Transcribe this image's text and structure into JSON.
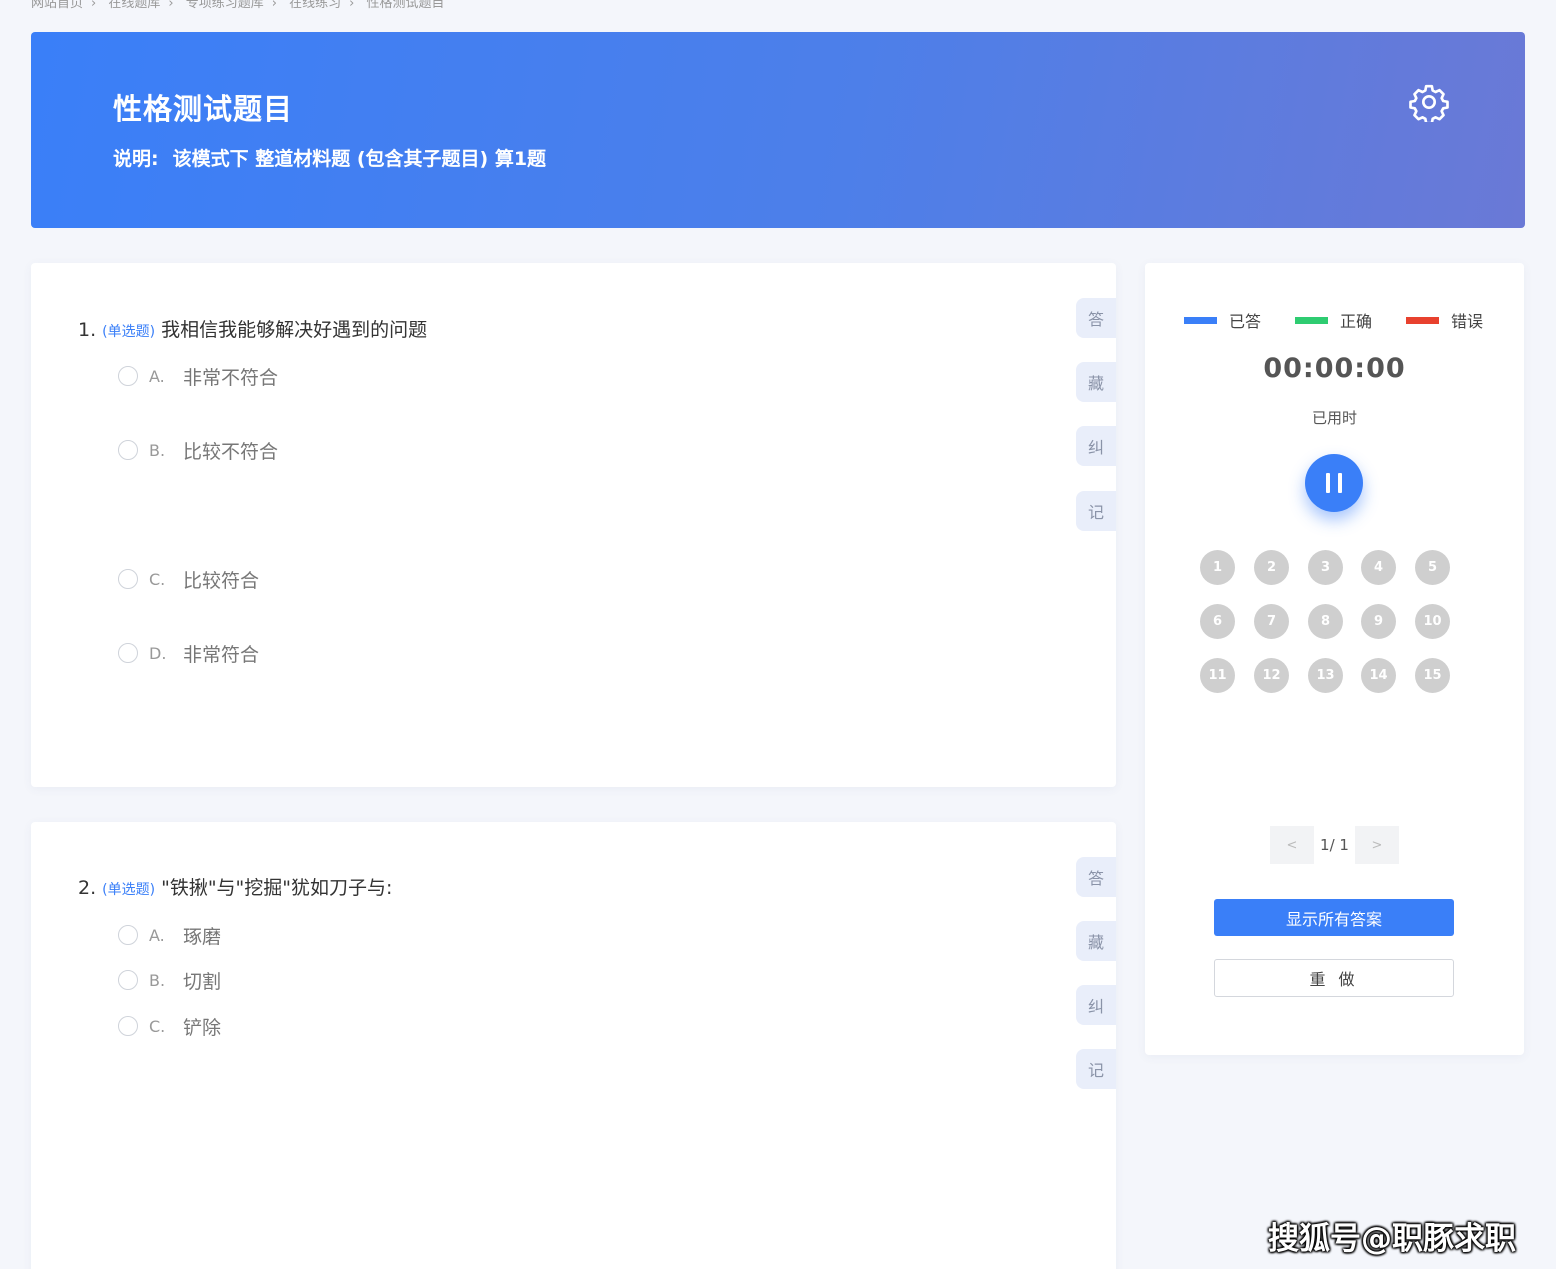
{
  "breadcrumb": [
    "网站首页",
    "在线题库",
    "专项练习题库",
    "在线练习",
    "性格测试题目"
  ],
  "header": {
    "title": "性格测试题目",
    "desc_label": "说明:",
    "desc_text": "该模式下 整道材料题 (包含其子题目) 算1题"
  },
  "questions": [
    {
      "number": "1.",
      "type": "(单选题)",
      "text": "我相信我能够解决好遇到的问题",
      "options": [
        {
          "letter": "A.",
          "text": "非常不符合"
        },
        {
          "letter": "B.",
          "text": "比较不符合"
        },
        {
          "letter": "C.",
          "text": "比较符合"
        },
        {
          "letter": "D.",
          "text": "非常符合"
        }
      ]
    },
    {
      "number": "2.",
      "type": "(单选题)",
      "text": "\"铁揪\"与\"挖掘\"犹如刀子与:",
      "options": [
        {
          "letter": "A.",
          "text": "琢磨"
        },
        {
          "letter": "B.",
          "text": "切割"
        },
        {
          "letter": "C.",
          "text": "铲除"
        }
      ]
    }
  ],
  "side_actions": [
    "答",
    "藏",
    "纠",
    "记"
  ],
  "panel": {
    "legend": [
      {
        "label": "已答",
        "color": "#3a7ff8"
      },
      {
        "label": "正确",
        "color": "#2ecc71"
      },
      {
        "label": "错误",
        "color": "#e8412e"
      }
    ],
    "timer": "00:00:00",
    "timer_label": "已用时",
    "question_numbers": [
      "1",
      "2",
      "3",
      "4",
      "5",
      "6",
      "7",
      "8",
      "9",
      "10",
      "11",
      "12",
      "13",
      "14",
      "15"
    ],
    "pager": {
      "prev": "<",
      "info": "1/ 1",
      "next": ">"
    },
    "show_answers_label": "显示所有答案",
    "redo_label": "重 做"
  },
  "watermark": "搜狐号@职豚求职",
  "icons": {
    "settings": "gear-icon",
    "pause": "pause-icon"
  }
}
